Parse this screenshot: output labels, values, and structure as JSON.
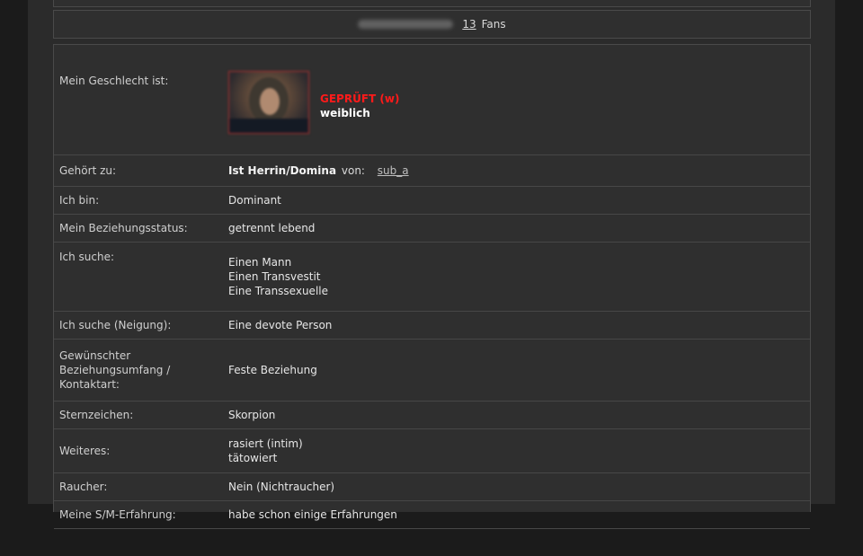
{
  "fans": {
    "count": "13",
    "label": "Fans"
  },
  "profile": {
    "gender": {
      "label": "Mein Geschlecht ist:",
      "badge": "GEPRÜFT (w)",
      "value": "weiblich"
    },
    "belongs": {
      "label": "Gehört zu:",
      "role": "Ist Herrin/Domina",
      "von": "von:",
      "link": "sub_a"
    },
    "rows": [
      {
        "label": "Ich bin:",
        "value": "Dominant"
      },
      {
        "label": "Mein Beziehungsstatus:",
        "value": "getrennt lebend"
      },
      {
        "label": "Ich suche:",
        "values": [
          "Einen Mann",
          "Einen Transvestit",
          "Eine Transsexuelle"
        ]
      },
      {
        "label": "Ich suche (Neigung):",
        "value": "Eine devote Person"
      },
      {
        "label": "Gewünschter Beziehungsumfang / Kontaktart:",
        "value": "Feste Beziehung"
      },
      {
        "label": "Sternzeichen:",
        "value": "Skorpion"
      },
      {
        "label": "Weiteres:",
        "values": [
          "rasiert (intim)",
          "tätowiert"
        ]
      },
      {
        "label": "Raucher:",
        "value": "Nein (Nichtraucher)"
      },
      {
        "label": "Meine S/M-Erfahrung:",
        "value": "habe schon einige Erfahrungen"
      }
    ]
  }
}
